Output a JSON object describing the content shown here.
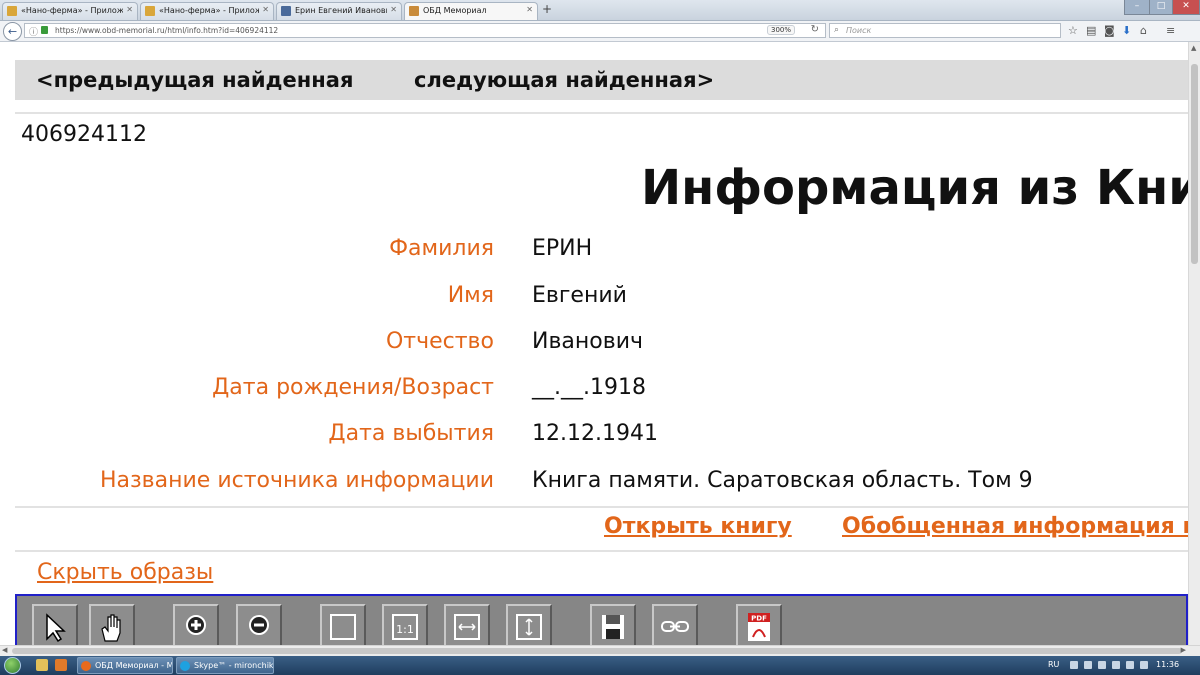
{
  "browser": {
    "tabs": [
      {
        "label": "«Нано-ферма» - Приложен",
        "active": false
      },
      {
        "label": "«Нано-ферма» - Приложен",
        "active": false
      },
      {
        "label": "Ерин Евгений Иванович. Па",
        "active": false
      },
      {
        "label": "ОБД Мемориал",
        "active": true
      }
    ],
    "url": "https://www.obd-memorial.ru/html/info.htm?id=406924112",
    "zoom": "300%",
    "search_placeholder": "Поиск"
  },
  "page": {
    "prev_link": "<предыдущая найденная",
    "next_link": "следующая найденная>",
    "record_id": "406924112",
    "heading": "Информация из Книги",
    "fields": [
      {
        "label": "Фамилия",
        "value": "ЕРИН"
      },
      {
        "label": "Имя",
        "value": "Евгений"
      },
      {
        "label": "Отчество",
        "value": "Иванович"
      },
      {
        "label": "Дата рождения/Возраст",
        "value": "__.__.1918"
      },
      {
        "label": "Дата выбытия",
        "value": "12.12.1941"
      },
      {
        "label": "Название источника информации",
        "value": "Книга памяти. Саратовская область. Том 9"
      }
    ],
    "open_book": "Открыть книгу",
    "summary_info": "Обобщенная информация и",
    "hide_images": "Скрыть образы",
    "viewer_tools": [
      "pointer-icon",
      "hand-icon",
      "zoom-in-icon",
      "zoom-out-icon",
      "fit-page-icon",
      "actual-size-icon",
      "fit-width-icon",
      "fit-height-icon",
      "save-icon",
      "link-icon",
      "pdf-icon"
    ]
  },
  "taskbar": {
    "items": [
      {
        "label": "ОБД Мемориал - M..."
      },
      {
        "label": "Skype™ - mironchikt..."
      }
    ],
    "lang": "RU",
    "clock": "11:36"
  },
  "colors": {
    "accent": "#e2661a",
    "nav_bg": "#dcdcdc",
    "toolbar_bg": "#868686",
    "toolbar_border": "#2020c8"
  }
}
